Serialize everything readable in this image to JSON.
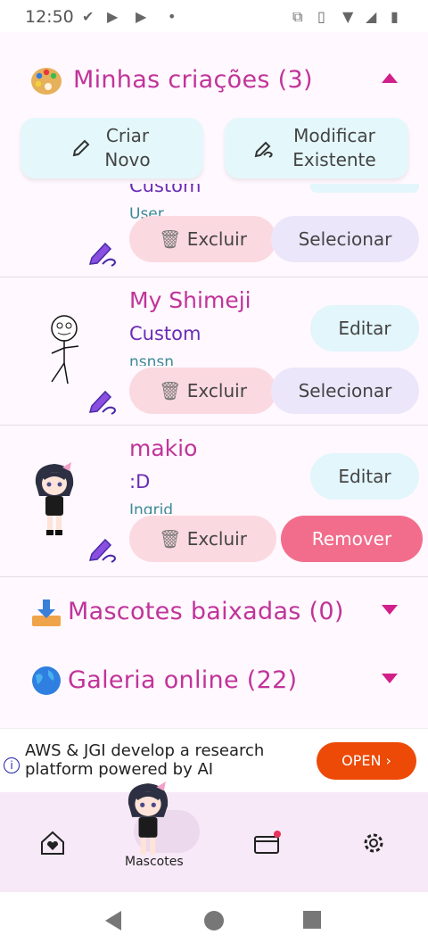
{
  "status_bar": {
    "time": "12:50"
  },
  "my_creations": {
    "title": "Minhas criações (3)",
    "icon": "palette-emoji"
  },
  "actions": {
    "create_new": "Criar\nNovo",
    "modify_existing": "Modificar\nExistente"
  },
  "cards": [
    {
      "name": "",
      "sub1": "Custom",
      "sub2": "User",
      "delete_label": "Excluir",
      "select_label": "Selecionar"
    },
    {
      "name": "My Shimeji",
      "sub1": "Custom",
      "sub2": "nsnsn",
      "edit_label": "Editar",
      "delete_label": "Excluir",
      "select_label": "Selecionar"
    },
    {
      "name": "makio",
      "sub1": ":D",
      "sub2": "Ingrid",
      "edit_label": "Editar",
      "delete_label": "Excluir",
      "remove_label": "Remover"
    }
  ],
  "downloaded": {
    "title": "Mascotes baixadas (0)",
    "icon": "download-tray-emoji"
  },
  "gallery": {
    "title": "Galeria online (22)",
    "icon": "globe-emoji"
  },
  "ad": {
    "text": "AWS & JGI develop a research\nplatform powered by AI",
    "cta": "OPEN ›"
  },
  "bottom_nav": {
    "mascots_label": "Mascotes"
  },
  "colors": {
    "accent": "#c0349a",
    "remove": "#f26d8c",
    "ad_cta": "#ec4a06"
  }
}
